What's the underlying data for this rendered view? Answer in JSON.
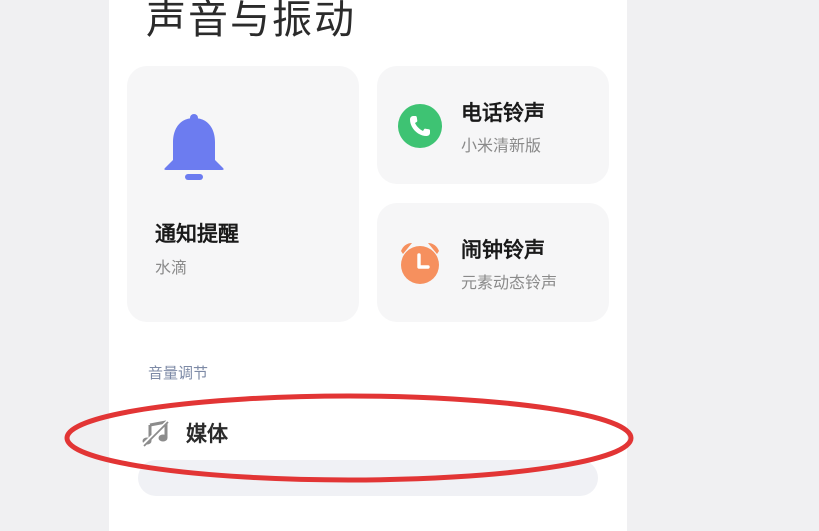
{
  "page": {
    "title": "声音与振动"
  },
  "cards": {
    "notification": {
      "title": "通知提醒",
      "subtitle": "水滴",
      "icon": "bell-icon",
      "color": "#6c7cf0"
    },
    "ringtone": {
      "title": "电话铃声",
      "subtitle": "小米清新版",
      "icon": "phone-icon",
      "color": "#3ec373"
    },
    "alarm": {
      "title": "闹钟铃声",
      "subtitle": "元素动态铃声",
      "icon": "alarm-clock-icon",
      "color": "#f6905e"
    }
  },
  "volume": {
    "section_label": "音量调节",
    "media_label": "媒体",
    "media_icon": "music-note-icon",
    "media_level": 0
  },
  "annotation": {
    "color": "#e23535"
  }
}
